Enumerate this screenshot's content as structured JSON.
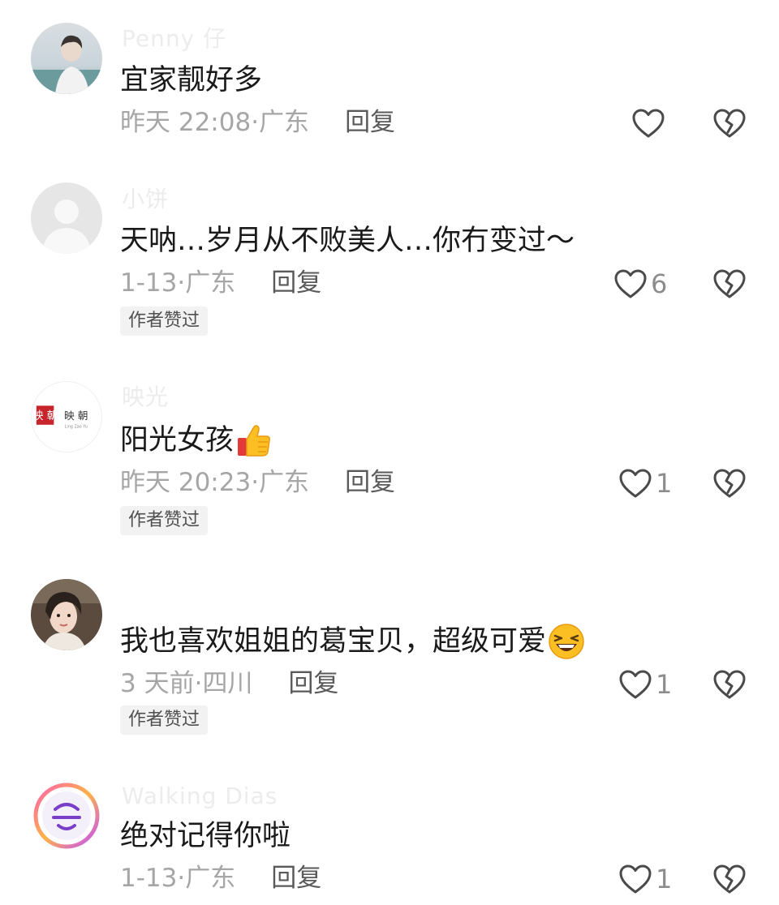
{
  "comments": [
    {
      "username": "Penny 仔",
      "content": "宜家靓好多",
      "time": "昨天 22:08",
      "separator": "·",
      "location": "广东",
      "reply_label": "回复",
      "like_count": "",
      "author_liked": ""
    },
    {
      "username": "小饼",
      "content": "天呐…岁月从不败美人…你冇变过～",
      "time": "1-13",
      "separator": "·",
      "location": "广东",
      "reply_label": "回复",
      "like_count": "6",
      "author_liked": "作者赞过"
    },
    {
      "username": "映光",
      "content": "阳光女孩",
      "time": "昨天 20:23",
      "separator": "·",
      "location": "广东",
      "reply_label": "回复",
      "like_count": "1",
      "author_liked": "作者赞过"
    },
    {
      "username": "",
      "content": "我也喜欢姐姐的葛宝贝，超级可爱",
      "time": "3 天前",
      "separator": "·",
      "location": "四川",
      "reply_label": "回复",
      "like_count": "1",
      "author_liked": "作者赞过"
    },
    {
      "username": "Walking Dias",
      "content": "绝对记得你啦",
      "time": "1-13",
      "separator": "·",
      "location": "广东",
      "reply_label": "回复",
      "like_count": "1",
      "author_liked": ""
    }
  ],
  "avatar_logo_text": {
    "line1": "映 朝",
    "line2": "Ling Zao Yu"
  },
  "icons": {
    "like": "heart-outline-icon",
    "dislike": "broken-heart-icon",
    "thumbs_up_emoji": "thumbs-up-emoji-icon",
    "laughing_emoji": "laughing-emoji-icon"
  },
  "colors": {
    "text_primary": "#1a1a1a",
    "text_meta": "#a6a6a6",
    "reply": "#5a5a5a",
    "badge_bg": "#f2f2f2",
    "icon_stroke": "#4a4a4a"
  }
}
